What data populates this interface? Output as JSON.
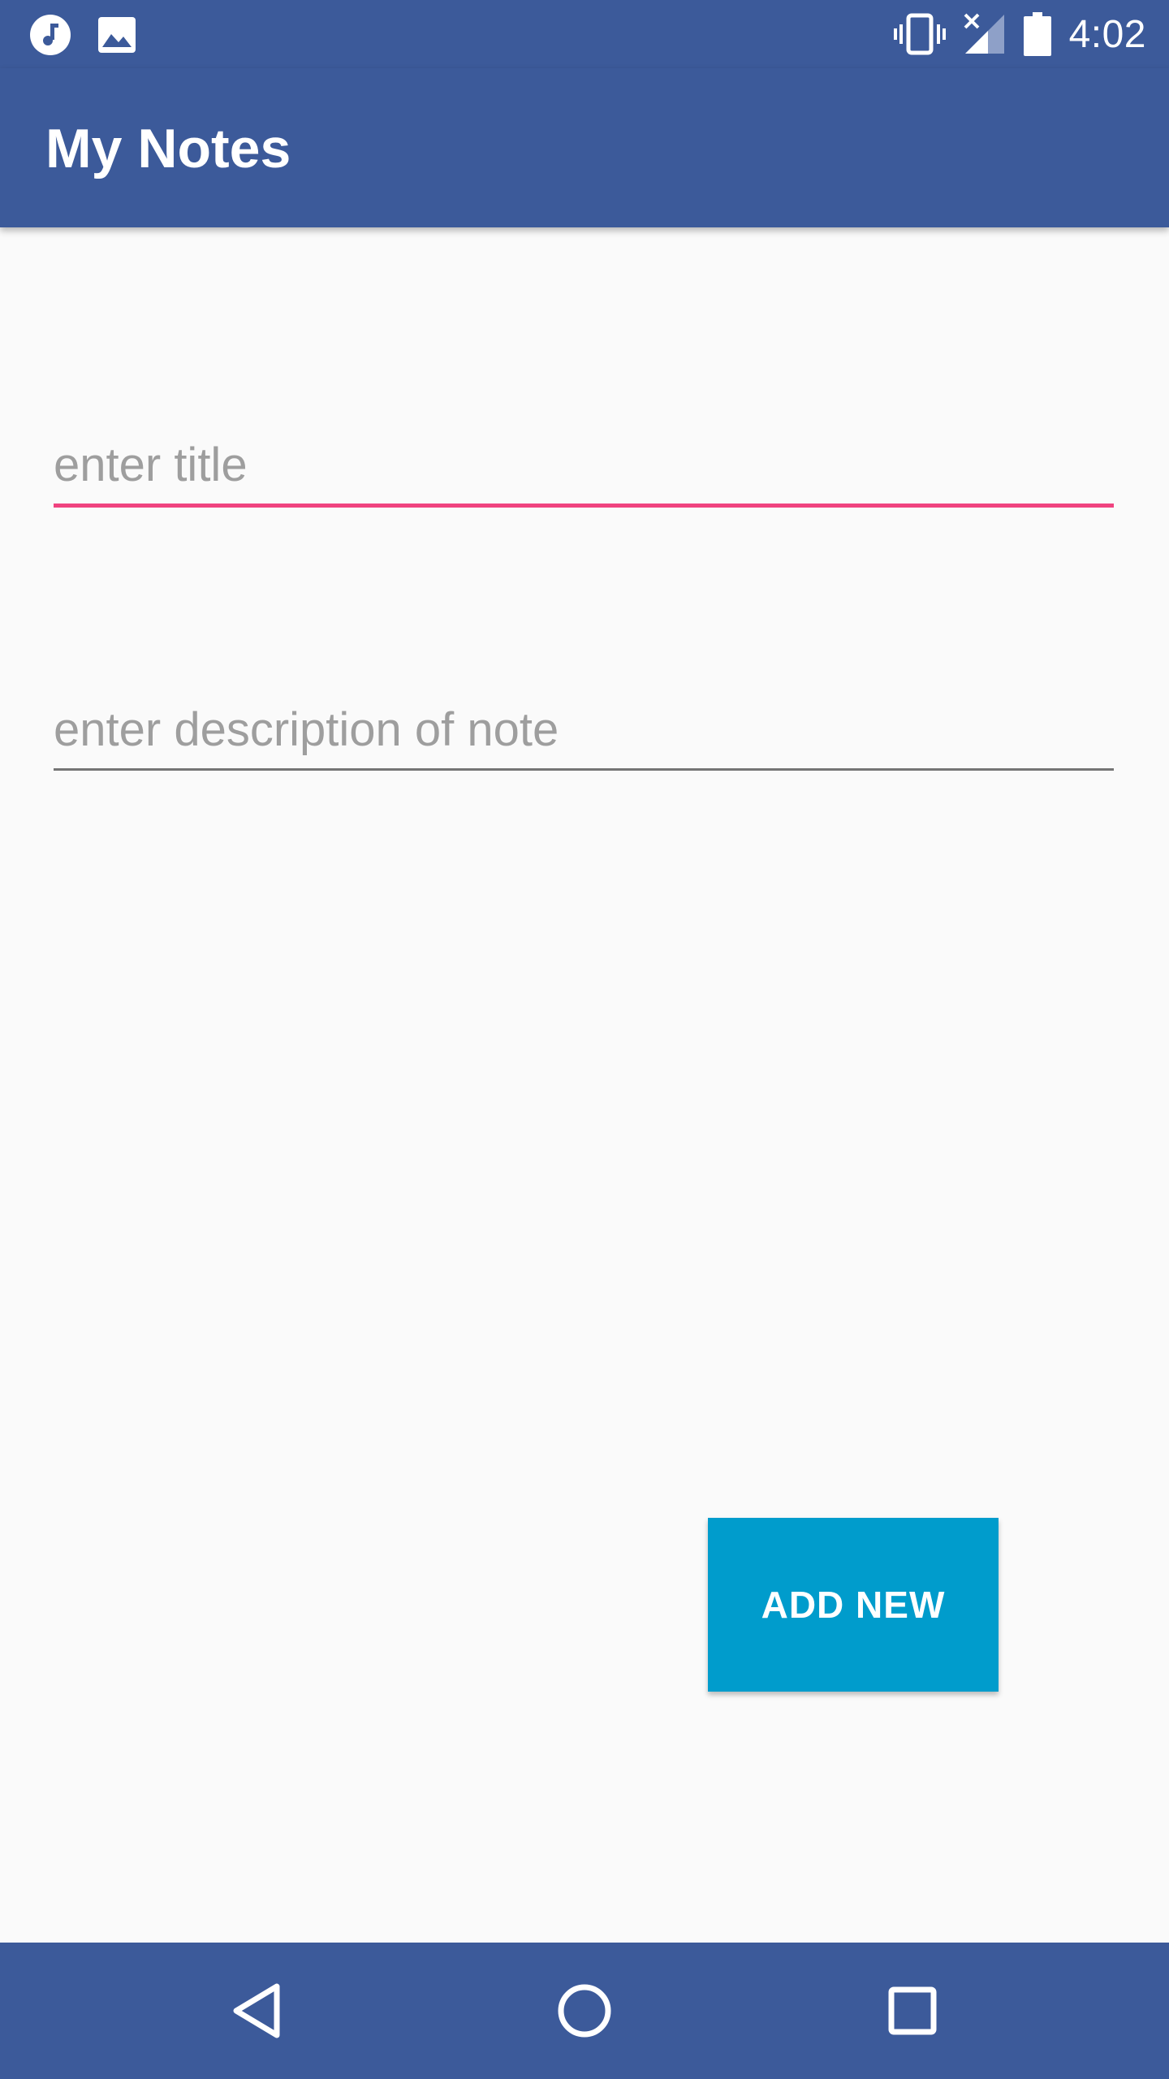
{
  "status_bar": {
    "time": "4:02",
    "left_icons": [
      "music-notification-icon",
      "image-notification-icon"
    ],
    "right_icons": [
      "vibrate-icon",
      "signal-no-data-icon",
      "battery-icon"
    ]
  },
  "app_bar": {
    "title": "My Notes"
  },
  "form": {
    "title_placeholder": "enter title",
    "title_value": "",
    "description_placeholder": "enter description of note",
    "description_value": "",
    "add_button_label": "ADD NEW"
  },
  "nav_bar": {
    "buttons": [
      "back-icon",
      "home-icon",
      "recents-icon"
    ]
  },
  "colors": {
    "primary": "#3c5a9a",
    "accent": "#f0437f",
    "button": "#009ccc",
    "background": "#fafafa"
  }
}
